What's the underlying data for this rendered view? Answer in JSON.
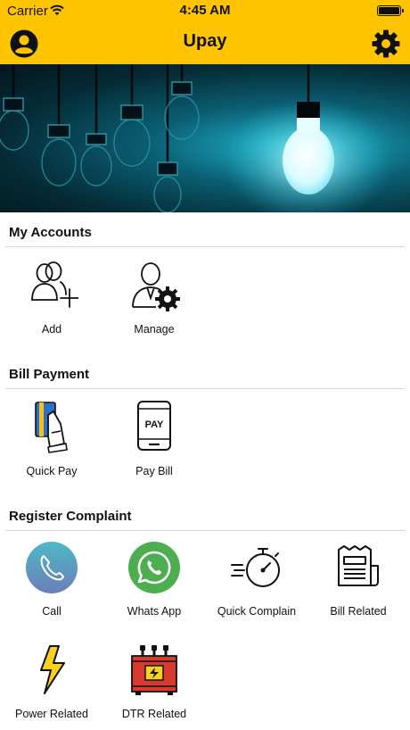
{
  "status_bar": {
    "carrier": "Carrier",
    "time": "4:45 AM"
  },
  "nav": {
    "title": "Upay",
    "left_icon": "profile-icon",
    "right_icon": "settings-icon"
  },
  "colors": {
    "brand_yellow": "#ffc400",
    "divider": "#d6d6d6",
    "call_teal": "#3aa6b0",
    "whatsapp_green": "#4cae4f",
    "dtr_red": "#d93a2e"
  },
  "sections": {
    "accounts": {
      "title": "My Accounts",
      "items": [
        {
          "label": "Add",
          "icon": "add-user-icon"
        },
        {
          "label": "Manage",
          "icon": "manage-user-icon"
        }
      ]
    },
    "bill": {
      "title": "Bill Payment",
      "items": [
        {
          "label": "Quick Pay",
          "icon": "card-pay-icon"
        },
        {
          "label": "Pay Bill",
          "icon": "phone-pay-icon"
        }
      ]
    },
    "complaint": {
      "title": "Register Complaint",
      "items": [
        {
          "label": "Call",
          "icon": "phone-call-icon"
        },
        {
          "label": "Whats App",
          "icon": "whatsapp-icon"
        },
        {
          "label": "Quick Complain",
          "icon": "stopwatch-icon"
        },
        {
          "label": "Bill Related",
          "icon": "newspaper-icon"
        },
        {
          "label": "Power Related",
          "icon": "lightning-icon"
        },
        {
          "label": "DTR Related",
          "icon": "transformer-icon"
        }
      ]
    }
  }
}
